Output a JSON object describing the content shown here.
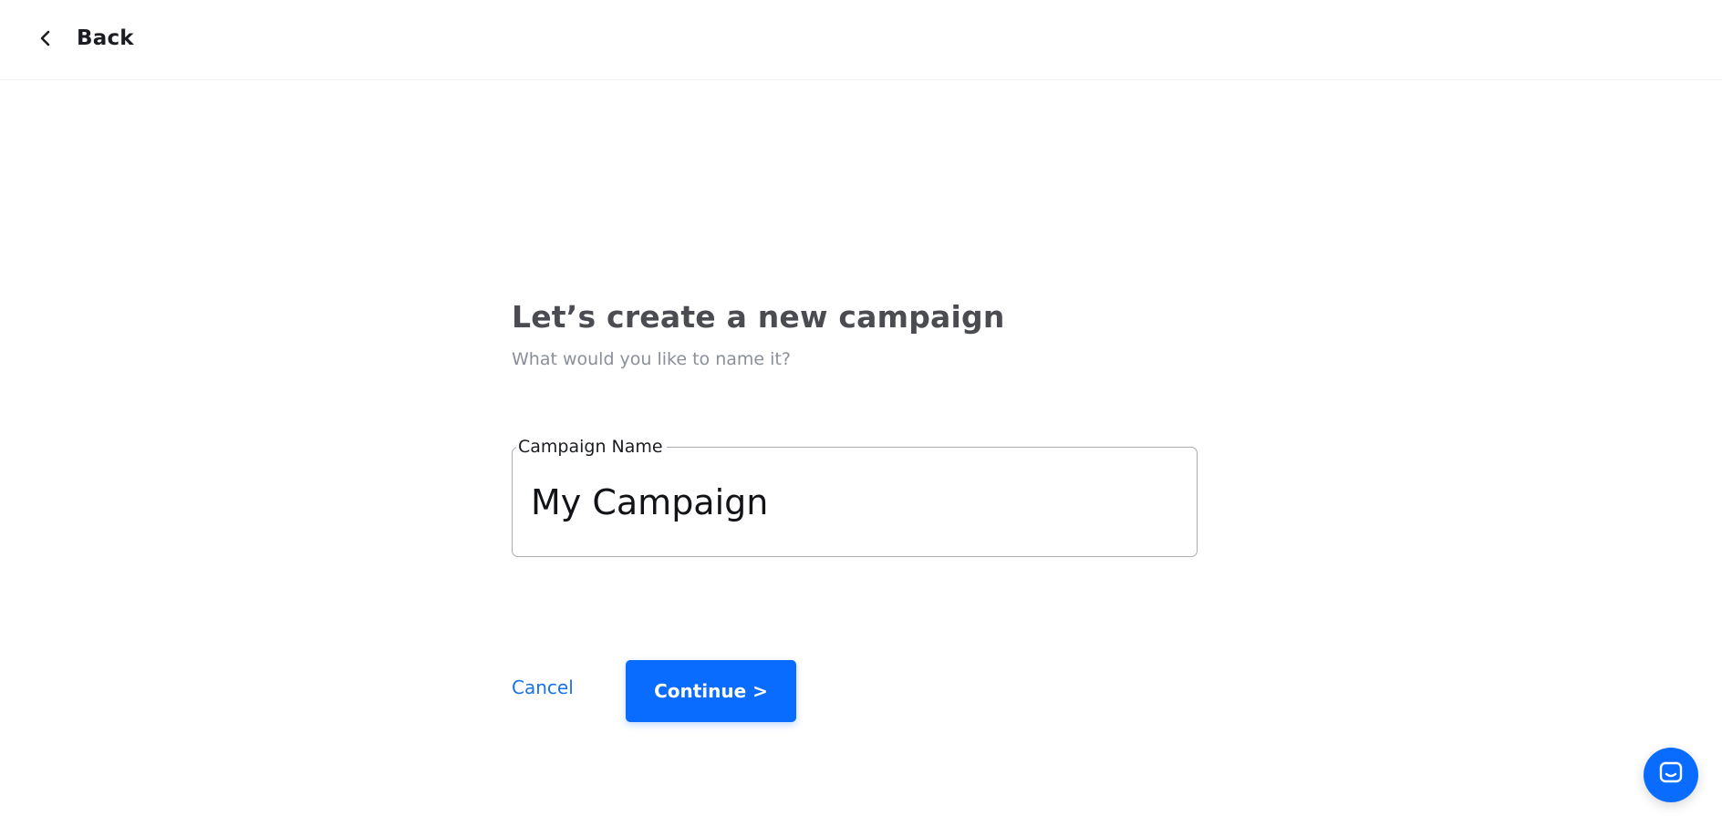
{
  "header": {
    "back_label": "Back",
    "back_icon": "chevron-left-icon"
  },
  "main": {
    "title": "Let’s create a new campaign",
    "subtitle": "What would you like to name it?",
    "campaign_name_field": {
      "label": "Campaign Name",
      "value": "My Campaign"
    },
    "cancel_label": "Cancel",
    "continue_label": "Continue >"
  },
  "chat_widget": {
    "icon": "chat-icon"
  },
  "colors": {
    "accent": "#0a6cff",
    "link": "#1a73e8",
    "title": "#4a4c52",
    "subtitle": "#8a8f9a"
  }
}
